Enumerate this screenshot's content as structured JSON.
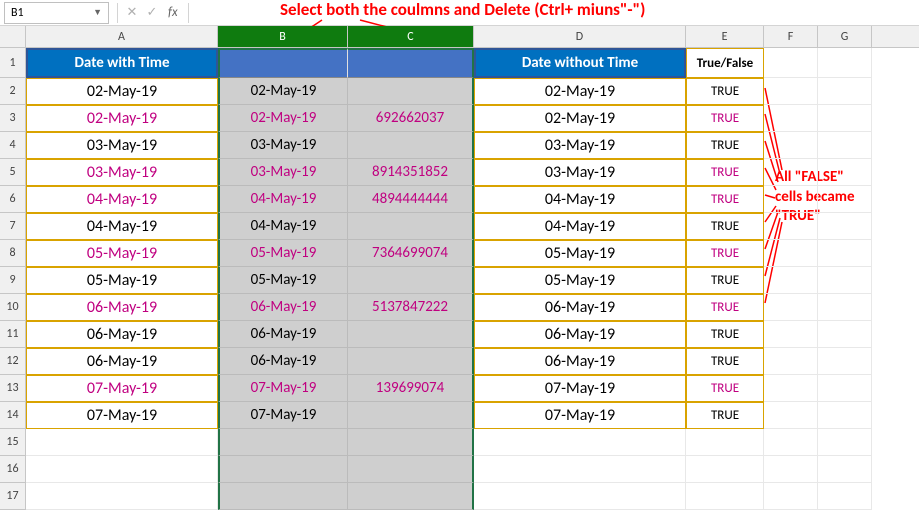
{
  "formula_bar": {
    "name_box": "B1",
    "cancel": "✕",
    "confirm": "✓",
    "fx": "fx"
  },
  "col_headers": {
    "a": "A",
    "b": "B",
    "c": "C",
    "d": "D",
    "e": "E",
    "f": "F",
    "g": "G"
  },
  "headers": {
    "a": "Date with Time",
    "d": "Date without Time",
    "e": "True/False"
  },
  "rows": [
    {
      "n": "2",
      "a": "02-May-19",
      "b": "02-May-19",
      "c": "",
      "d": "02-May-19",
      "e": "TRUE",
      "pink": false
    },
    {
      "n": "3",
      "a": "02-May-19",
      "b": "02-May-19",
      "c": "692662037",
      "d": "02-May-19",
      "e": "TRUE",
      "pink": true
    },
    {
      "n": "4",
      "a": "03-May-19",
      "b": "03-May-19",
      "c": "",
      "d": "03-May-19",
      "e": "TRUE",
      "pink": false
    },
    {
      "n": "5",
      "a": "03-May-19",
      "b": "03-May-19",
      "c": "8914351852",
      "d": "03-May-19",
      "e": "TRUE",
      "pink": true
    },
    {
      "n": "6",
      "a": "04-May-19",
      "b": "04-May-19",
      "c": "4894444444",
      "d": "04-May-19",
      "e": "TRUE",
      "pink": true
    },
    {
      "n": "7",
      "a": "04-May-19",
      "b": "04-May-19",
      "c": "",
      "d": "04-May-19",
      "e": "TRUE",
      "pink": false
    },
    {
      "n": "8",
      "a": "05-May-19",
      "b": "05-May-19",
      "c": "7364699074",
      "d": "05-May-19",
      "e": "TRUE",
      "pink": true
    },
    {
      "n": "9",
      "a": "05-May-19",
      "b": "05-May-19",
      "c": "",
      "d": "05-May-19",
      "e": "TRUE",
      "pink": false
    },
    {
      "n": "10",
      "a": "06-May-19",
      "b": "06-May-19",
      "c": "5137847222",
      "d": "06-May-19",
      "e": "TRUE",
      "pink": true
    },
    {
      "n": "11",
      "a": "06-May-19",
      "b": "06-May-19",
      "c": "",
      "d": "06-May-19",
      "e": "TRUE",
      "pink": false
    },
    {
      "n": "12",
      "a": "06-May-19",
      "b": "06-May-19",
      "c": "",
      "d": "06-May-19",
      "e": "TRUE",
      "pink": false
    },
    {
      "n": "13",
      "a": "07-May-19",
      "b": "07-May-19",
      "c": "139699074",
      "d": "07-May-19",
      "e": "TRUE",
      "pink": true
    },
    {
      "n": "14",
      "a": "07-May-19",
      "b": "07-May-19",
      "c": "",
      "d": "07-May-19",
      "e": "TRUE",
      "pink": false
    }
  ],
  "empty_rows": [
    "15",
    "16",
    "17"
  ],
  "annotation_top": "Select both the coulmns and Delete (Ctrl+ miuns\"-\")",
  "annotation_right_l1": "All \"FALSE\"",
  "annotation_right_l2": "cells became",
  "annotation_right_l3": "\"TRUE\""
}
